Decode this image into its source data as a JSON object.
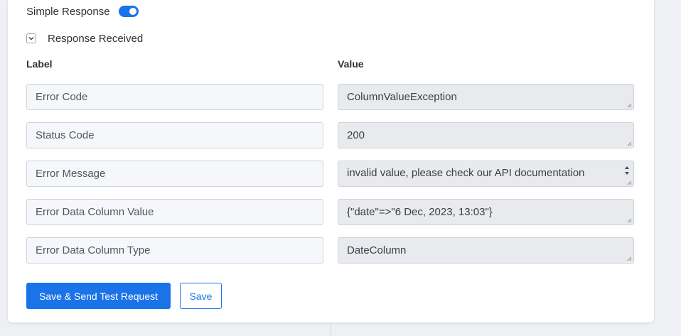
{
  "simple_response": {
    "label": "Simple Response",
    "enabled": true
  },
  "response_received": {
    "label": "Response Received",
    "expanded": true
  },
  "table": {
    "label_header": "Label",
    "value_header": "Value",
    "rows": [
      {
        "label": "Error Code",
        "value": "ColumnValueException"
      },
      {
        "label": "Status Code",
        "value": "200"
      },
      {
        "label": "Error Message",
        "value": "invalid value, please check our API documentation"
      },
      {
        "label": "Error Data Column Value",
        "value": "{\"date\"=>\"6 Dec, 2023, 13:03\"}"
      },
      {
        "label": "Error Data Column Type",
        "value": "DateColumn"
      }
    ]
  },
  "buttons": {
    "save_send_label": "Save & Send Test Request",
    "save_label": "Save"
  },
  "colors": {
    "accent": "#1a73e8",
    "label_field_bg": "#f5f7fa",
    "value_field_bg": "#e8eaed"
  }
}
